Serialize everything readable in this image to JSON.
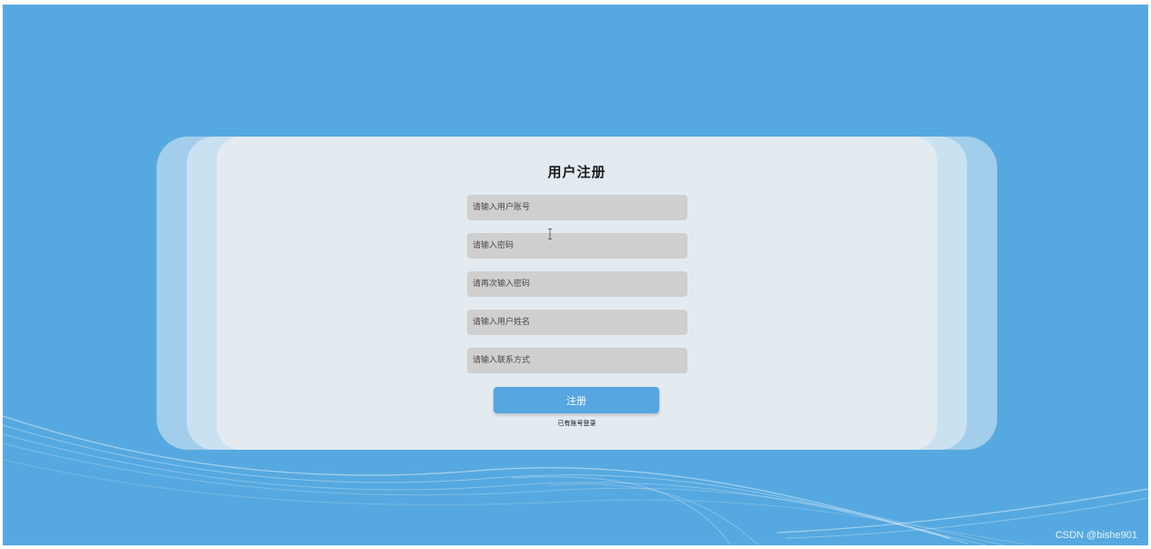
{
  "page": {
    "title": "用户注册"
  },
  "form": {
    "account_placeholder": "请输入用户账号",
    "password_placeholder": "请输入密码",
    "confirm_password_placeholder": "请再次输入密码",
    "name_placeholder": "请输入用户姓名",
    "contact_placeholder": "请输入联系方式",
    "submit_label": "注册",
    "login_link": "已有账号登录"
  },
  "watermark": "CSDN @bishe901",
  "colors": {
    "background": "#56a9e0",
    "panel": "#e3ebf1",
    "input": "#cfcfd0",
    "button": "#56a6e2"
  },
  "icons": {
    "cursor": "text-cursor-icon"
  }
}
